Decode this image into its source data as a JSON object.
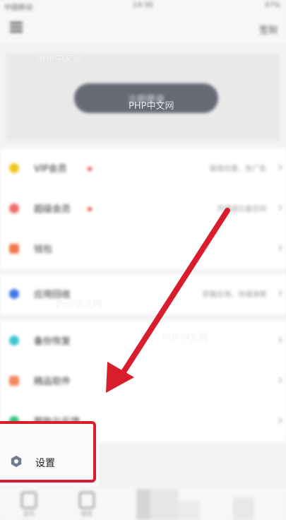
{
  "status_bar": {
    "carrier": "中国移动",
    "time": "14:30",
    "battery": "47%"
  },
  "top_bar": {
    "right_label": "签到"
  },
  "banner": {
    "button_label": "立即登录"
  },
  "list_group1": [
    {
      "label": "VIP会员",
      "sub": "超值优惠，免广告",
      "icon_color": "#f3c51c",
      "red_dot": true
    },
    {
      "label": "超级会员",
      "sub": "开通送云盘空间",
      "icon_color": "#ec6a6a",
      "red_dot": true
    },
    {
      "label": "钱包",
      "sub": "",
      "icon_color": "#f0764a",
      "red_dot": false
    }
  ],
  "list_group2": [
    {
      "label": "应用回收",
      "sub": "卸载应用，存储清理",
      "icon_color": "#3f78e6"
    }
  ],
  "list_group3": [
    {
      "label": "备份恢复",
      "sub": "",
      "icon_color": "#3cc3cf"
    },
    {
      "label": "精品软件",
      "sub": "",
      "icon_color": "#f3865c"
    },
    {
      "label": "帮助与反馈",
      "sub": "",
      "icon_color": "#35c27e"
    }
  ],
  "settings": {
    "label": "设置"
  },
  "tab_bar": {
    "tab1_label": "首页",
    "tab2_label": "推荐"
  },
  "watermark": "PHP中文网",
  "colors": {
    "highlight": "#d81e2c"
  }
}
